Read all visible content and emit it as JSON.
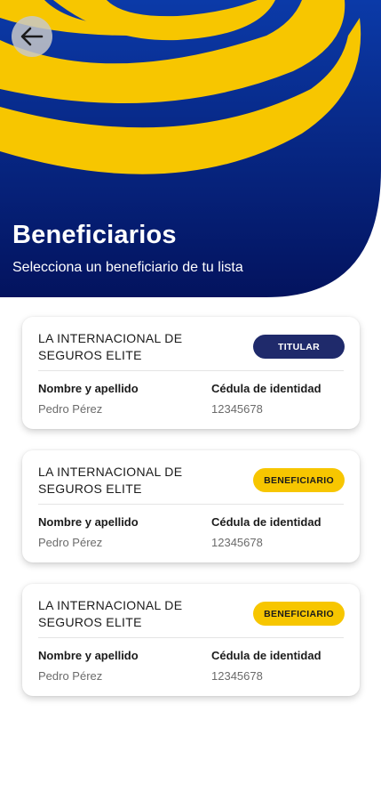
{
  "header": {
    "back_icon": "arrow-left-icon",
    "title": "Beneficiarios",
    "subtitle": "Selecciona un beneficiario de tu lista"
  },
  "colors": {
    "navy": "#0a2a8c",
    "dark_navy": "#03135e",
    "yellow": "#f7c600",
    "badge_navy": "#1f2a6b"
  },
  "labels": {
    "name": "Nombre y apellido",
    "id": "Cédula de identidad"
  },
  "cards": [
    {
      "company": "LA INTERNACIONAL DE SEGUROS ELITE",
      "badge": "TITULAR",
      "badge_type": "titular",
      "name": "Pedro Pérez",
      "id": "12345678"
    },
    {
      "company": "LA INTERNACIONAL DE SEGUROS ELITE",
      "badge": "BENEFICIARIO",
      "badge_type": "beneficiario",
      "name": "Pedro Pérez",
      "id": "12345678"
    },
    {
      "company": "LA INTERNACIONAL DE SEGUROS ELITE",
      "badge": "BENEFICIARIO",
      "badge_type": "beneficiario",
      "name": "Pedro Pérez",
      "id": "12345678"
    }
  ]
}
